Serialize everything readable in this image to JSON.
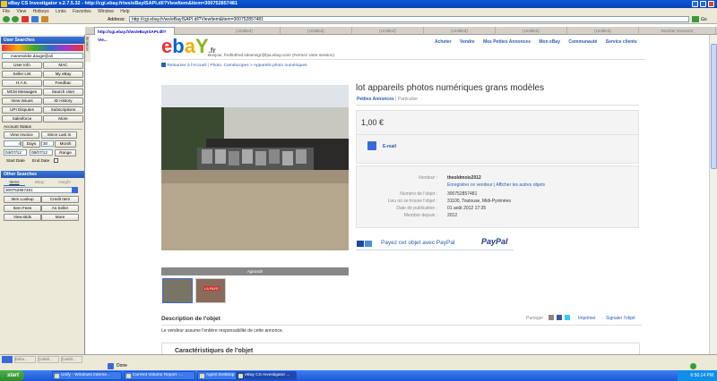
{
  "window": {
    "title": "eBay CS Investigator v.2.7.5.32 - http://cgi.ebay.fr/ws/eBayISAPI.dll?ViewItem&item=300752857481"
  },
  "menu": [
    "File",
    "View",
    "Hotkeys",
    "Links",
    "Favorites",
    "Window",
    "Help"
  ],
  "address": {
    "label": "Address:",
    "value": "http://cgi.ebay.fr/ws/eBayISAPI.dll?ViewItem&item=300752857481",
    "go": "Go"
  },
  "tabs": {
    "browser_label": "Browser",
    "active": "http://cgi.ebay.fr/ws/eBayISAPI.dll?Vie...",
    "untitled": "(Untitled)",
    "extra": "Number Extractor"
  },
  "sidebar": {
    "user_searches": "User Searches",
    "user_value": "manesoldie.dauge@ali",
    "rows": [
      [
        "User Info",
        "MAC"
      ],
      [
        "Seller List",
        "My eBay"
      ],
      [
        "H.A.K.",
        "Feedbac"
      ],
      [
        "MCM Messages",
        "Search User"
      ],
      [
        "View Issues",
        "ID History"
      ],
      [
        "UPI Disputes",
        "Subscriptions"
      ],
      [
        "Salesforce",
        "More"
      ]
    ],
    "account_status": "Account Status",
    "view_invoice": "View Invoice",
    "since_last": "Since Last In",
    "days_value": "4",
    "days": "Days",
    "month_value": "30",
    "month": "Month",
    "start_value": "04/07/12",
    "end_value": "08/07/12",
    "range": "Range",
    "start_date": "Start Date",
    "end_date": "End Date",
    "other_searches": "Other Searches",
    "other_tabs": [
      "Items",
      "eBay",
      "Insight"
    ],
    "item_value": "300752857481",
    "rows2": [
      [
        "Item Lookup",
        "Credit Item"
      ],
      [
        "Item Fees",
        "As Seller"
      ],
      [
        "View Bids",
        "More"
      ]
    ]
  },
  "page": {
    "logo": {
      "e": "e",
      "b": "b",
      "a": "a",
      "y": "Y",
      "fr": ".fr"
    },
    "greeting": "Bonjour, fred54fred.sdonnegr@fpa.ebay.com! (Fermez votre session)",
    "nav": [
      "Acheter",
      "Vendre",
      "Mes Petites Annonces",
      "Mon eBay",
      "Communauté",
      "Service clients"
    ],
    "breadcrumb_back": "Retourner à l'Accueil",
    "breadcrumb": "Photo, Caméscopes > Appareils photo numériques",
    "title": "lot appareils photos numériques grans modèles",
    "annonce_type": "Petites Annonces",
    "annonce_sep": "| Particulier",
    "price": "1,00 €",
    "email": "E-mail",
    "details": [
      {
        "label": "Vendeur :",
        "value": "theoldmois2012"
      },
      {
        "label": "",
        "value": "Enregistrer ce vendeur | Afficher les autres objets"
      },
      {
        "label": "Numéro de l'objet :",
        "value": "300752857481"
      },
      {
        "label": "Lieu où se trouve l'objet :",
        "value": "31100, Toulouse, Midi-Pyrénées"
      },
      {
        "label": "Date de publication :",
        "value": "01 août 2012 17:35"
      },
      {
        "label": "Membre depuis :",
        "value": "2012"
      }
    ],
    "paypal_text": "Payez cet objet avec PayPal",
    "paypal_logo": "PayPal",
    "enlarge": "Agrandir",
    "thumb2_text": "LA PAYE",
    "desc_title": "Description de l'objet",
    "share": "Partager",
    "print": "Imprimer",
    "report": "Signaler l'objet",
    "responsibility": "Le vendeur assume l'entière responsabilité de cette annonce.",
    "characteristics": "Caractéristiques de l'objet"
  },
  "status": {
    "small_tabs": [
      "Esbo...",
      "(Untitl...",
      "(Untitl..."
    ],
    "done": "Done"
  },
  "taskbar": {
    "start": "start",
    "items": [
      "Unify - Windows Interne...",
      "Current Volume Report -...",
      "Agent Desktop - v.3.5.0...",
      "eBay CS Investigator ..."
    ],
    "time": "6:56:14 PM"
  },
  "colors": {
    "xp_blue": "#0a58d8",
    "ebay_red": "#e53238",
    "ebay_blue": "#0064d2",
    "ebay_yellow": "#f5af02",
    "ebay_green": "#86b817"
  }
}
